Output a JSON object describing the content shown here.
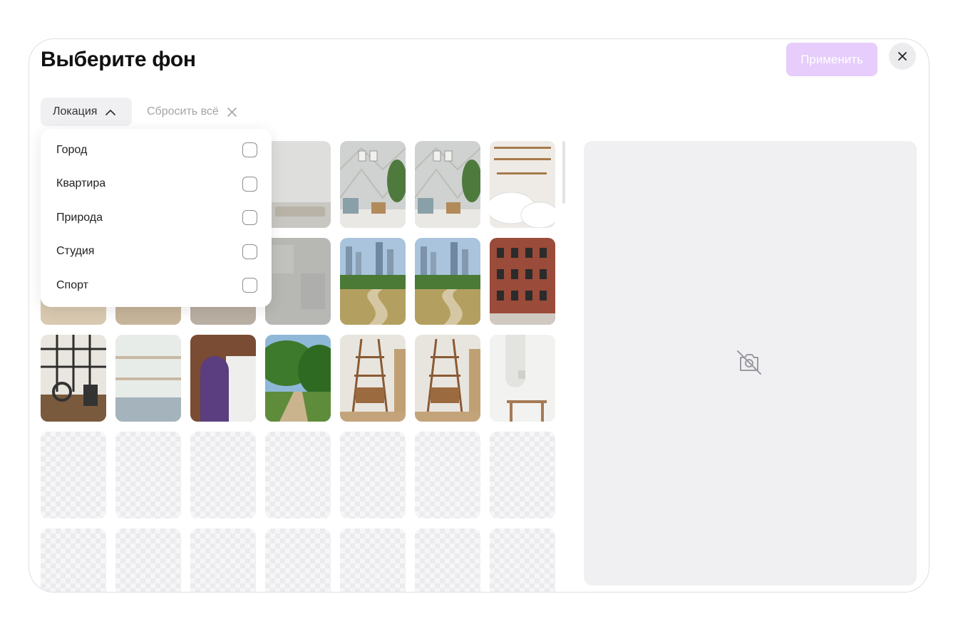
{
  "modal": {
    "title": "Выберите фон",
    "apply_label": "Применить",
    "close_icon": "close-icon"
  },
  "filters": {
    "location_label": "Локация",
    "location_icon": "chevron-up-icon",
    "reset_label": "Сбросить всё",
    "reset_icon": "x-icon"
  },
  "dropdown": {
    "options": [
      {
        "label": "Город",
        "checked": false
      },
      {
        "label": "Квартира",
        "checked": false
      },
      {
        "label": "Природа",
        "checked": false
      },
      {
        "label": "Студия",
        "checked": false
      },
      {
        "label": "Спорт",
        "checked": false
      }
    ]
  },
  "gallery": {
    "rows": [
      [
        "beach-icon",
        "interior-icon",
        "interior-icon",
        "living-room-icon",
        "scandi-room-icon",
        "scandi-room-icon",
        "bathroom-icon"
      ],
      [
        "beach-icon",
        "interior-icon",
        "cafe-icon",
        "concrete-wall-icon",
        "park-city-icon",
        "park-city-icon",
        "brick-building-icon"
      ],
      [
        "gym-icon",
        "kitchen-shelves-icon",
        "purple-door-icon",
        "forest-path-icon",
        "boho-shelves-icon",
        "boho-shelves-icon",
        "white-interior-icon"
      ],
      [
        "empty",
        "empty",
        "empty",
        "empty",
        "empty",
        "empty",
        "empty"
      ],
      [
        "empty",
        "empty",
        "empty",
        "empty",
        "empty",
        "empty",
        "empty"
      ]
    ]
  },
  "preview": {
    "icon": "no-photo-icon"
  },
  "colors": {
    "accent_disabled": "#e6cdfb",
    "panel_bg": "#f0f0f3"
  }
}
